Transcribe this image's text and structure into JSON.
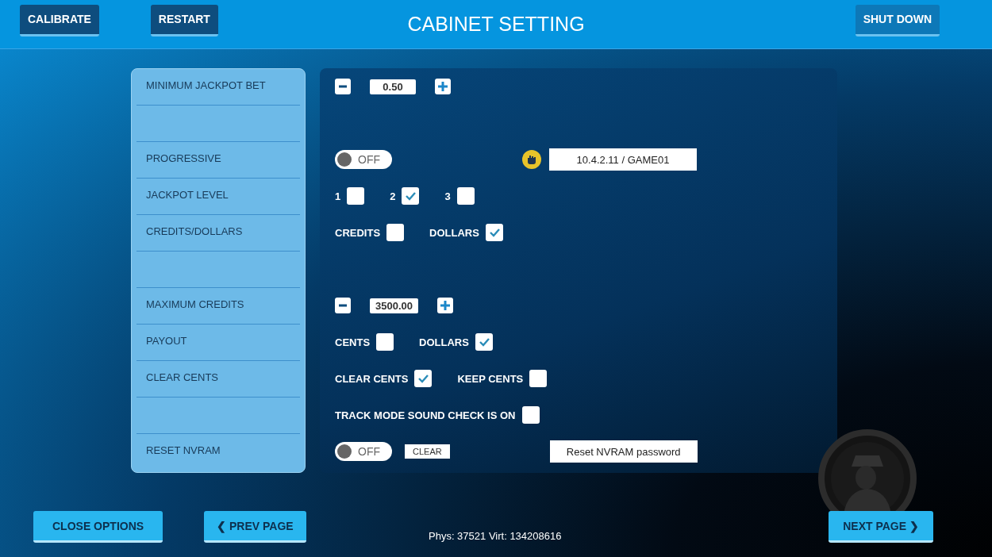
{
  "header": {
    "left_buttons": [
      "CALIBRATE",
      "RESTART"
    ],
    "title": "CABINET SETTING",
    "right_button": "SHUT DOWN"
  },
  "settings": [
    {
      "kind": "setting",
      "label": "MINIMUM JACKPOT BET",
      "controls": [
        {
          "kind": "stepper",
          "value": "0.50"
        }
      ]
    },
    {
      "kind": "blank"
    },
    {
      "kind": "setting",
      "label": "PROGRESSIVE",
      "controls": [
        {
          "kind": "toggle",
          "text": "OFF",
          "on": false
        },
        {
          "kind": "address",
          "value": "10.4.2.11 / GAME01"
        }
      ]
    },
    {
      "kind": "setting",
      "label": "JACKPOT LEVEL",
      "controls": [
        {
          "kind": "checkbox",
          "text": "1",
          "checked": false
        },
        {
          "kind": "checkbox",
          "text": "2",
          "checked": true
        },
        {
          "kind": "checkbox",
          "text": "3",
          "checked": false
        }
      ]
    },
    {
      "kind": "setting",
      "label": "CREDITS/DOLLARS",
      "controls": [
        {
          "kind": "checkbox",
          "text": "CREDITS",
          "checked": false
        },
        {
          "kind": "checkbox",
          "text": "DOLLARS",
          "checked": true
        }
      ]
    },
    {
      "kind": "blank"
    },
    {
      "kind": "setting",
      "label": "MAXIMUM CREDITS",
      "controls": [
        {
          "kind": "stepper",
          "value": "3500.00"
        }
      ]
    },
    {
      "kind": "setting",
      "label": "PAYOUT",
      "controls": [
        {
          "kind": "checkbox",
          "text": "CENTS",
          "checked": false
        },
        {
          "kind": "checkbox",
          "text": "DOLLARS",
          "checked": true
        }
      ]
    },
    {
      "kind": "setting",
      "label": "CLEAR CENTS",
      "controls": [
        {
          "kind": "checkbox",
          "text": "CLEAR CENTS",
          "checked": true
        },
        {
          "kind": "checkbox",
          "text": "KEEP CENTS",
          "checked": false
        }
      ]
    },
    {
      "kind": "unlabeled",
      "controls": [
        {
          "kind": "checkbox",
          "text": "TRACK MODE SOUND CHECK IS ON",
          "checked": false
        }
      ]
    },
    {
      "kind": "setting",
      "label": "RESET NVRAM",
      "controls": [
        {
          "kind": "toggle",
          "text": "OFF",
          "on": false
        },
        {
          "kind": "button",
          "text": "CLEAR"
        },
        {
          "kind": "field",
          "value": "Reset NVRAM password"
        }
      ]
    }
  ],
  "footer": {
    "close": "CLOSE OPTIONS",
    "prev": "❮ PREV PAGE",
    "status": "Phys: 37521 Virt: 134208616",
    "next": "NEXT PAGE ❯"
  }
}
